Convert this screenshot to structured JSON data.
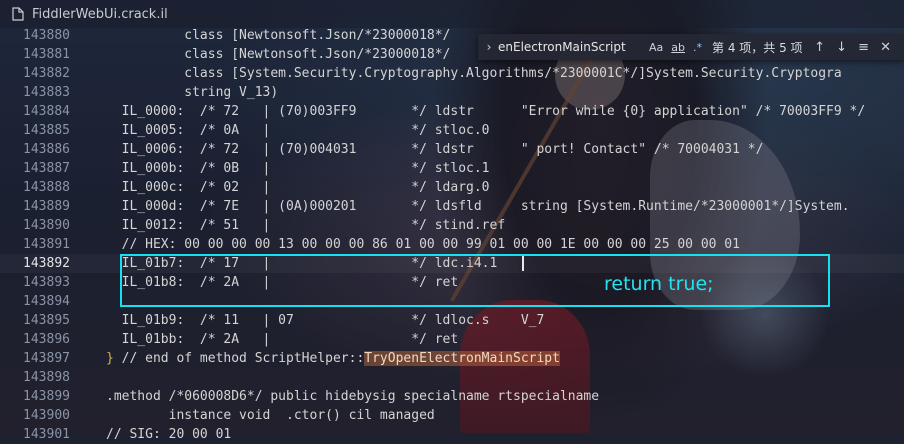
{
  "tab": {
    "title": "FiddlerWebUi.crack.il"
  },
  "find": {
    "query": "enElectronMainScript",
    "match_case_label": "Aa",
    "whole_word_label": "ab",
    "regex_label": ".*",
    "result_count": "第 4 项，共 5 项"
  },
  "annotation": {
    "text": "return true;"
  },
  "lines": [
    {
      "num": "143880",
      "text": "          class [Newtonsoft.Json/*23000018*/"
    },
    {
      "num": "143881",
      "text": "          class [Newtonsoft.Json/*23000018*/"
    },
    {
      "num": "143882",
      "text": "          class [System.Security.Cryptography.Algorithms/*2300001C*/]System.Security.Cryptogra"
    },
    {
      "num": "143883",
      "text": "          string V_13)"
    },
    {
      "num": "143884",
      "text": "  IL_0000:  /* 72   | (70)003FF9       */ ldstr      \"Error while {0} application\" /* 70003FF9 */"
    },
    {
      "num": "143885",
      "text": "  IL_0005:  /* 0A   |                  */ stloc.0"
    },
    {
      "num": "143886",
      "text": "  IL_0006:  /* 72   | (70)004031       */ ldstr      \" port! Contact\" /* 70004031 */"
    },
    {
      "num": "143887",
      "text": "  IL_000b:  /* 0B   |                  */ stloc.1"
    },
    {
      "num": "143888",
      "text": "  IL_000c:  /* 02   |                  */ ldarg.0"
    },
    {
      "num": "143889",
      "text": "  IL_000d:  /* 7E   | (0A)000201       */ ldsfld     string [System.Runtime/*23000001*/]System."
    },
    {
      "num": "143890",
      "text": "  IL_0012:  /* 51   |                  */ stind.ref"
    },
    {
      "num": "143891",
      "text": "  // HEX: 00 00 00 00 13 00 00 00 86 01 00 00 99 01 00 00 1E 00 00 00 25 00 00 01"
    },
    {
      "num": "143892",
      "text": "  IL_01b7:  /* 17   |                  */ ldc.i4.1",
      "active": true
    },
    {
      "num": "143893",
      "text": "  IL_01b8:  /* 2A   |                  */ ret"
    },
    {
      "num": "143894",
      "text": ""
    },
    {
      "num": "143895",
      "text": "  IL_01b9:  /* 11   | 07               */ ldloc.s    V_7"
    },
    {
      "num": "143896",
      "text": "  IL_01bb:  /* 2A   |                  */ ret"
    },
    {
      "num": "143897",
      "brace": "}",
      "pre": " // end of method ScriptHelper::",
      "hl": "TryOpenElectronMainScript"
    },
    {
      "num": "143898",
      "text": ""
    },
    {
      "num": "143899",
      "text": ".method /*060008D6*/ public hidebysig specialname rtspecialname"
    },
    {
      "num": "143900",
      "text": "        instance void  .ctor() cil managed"
    },
    {
      "num": "143901",
      "text": "// SIG: 20 00 01"
    }
  ]
}
